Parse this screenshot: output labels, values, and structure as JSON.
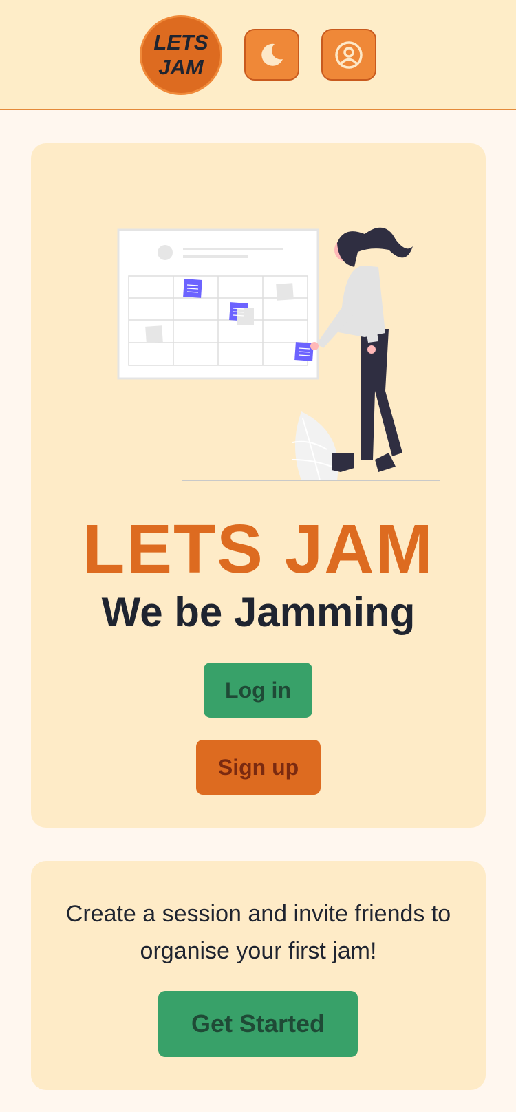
{
  "header": {
    "logo_line1": "LETS",
    "logo_line2": "JAM",
    "theme_icon": "moon-icon",
    "profile_icon": "user-circle-icon"
  },
  "hero": {
    "title": "LETS JAM",
    "subtitle": "We be Jamming",
    "login_label": "Log in",
    "signup_label": "Sign up"
  },
  "cta": {
    "text": "Create a session and invite friends to organise your first jam!",
    "button_label": "Get Started"
  },
  "colors": {
    "accent": "#dd6b20",
    "success": "#38a169",
    "background": "#fff7ef",
    "card": "#feebc7",
    "header": "#feedc8"
  }
}
